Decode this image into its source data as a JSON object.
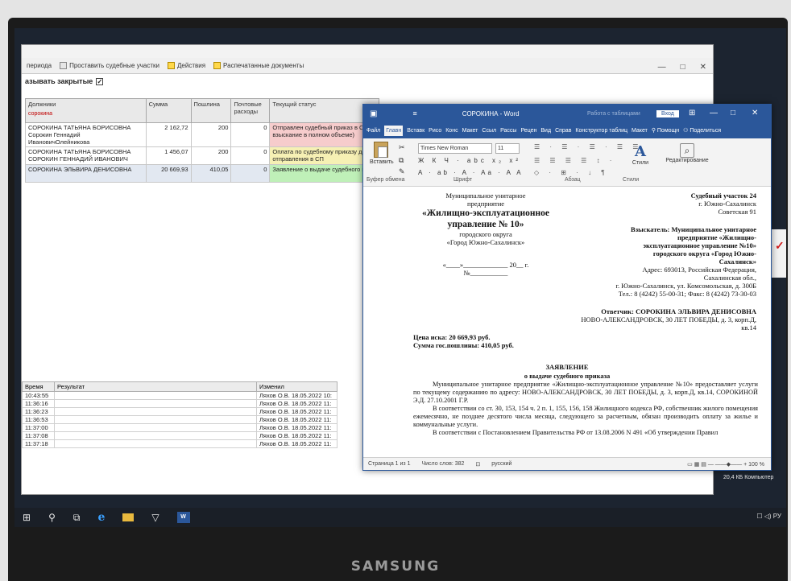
{
  "brand": "SAMSUNG",
  "app": {
    "menu": [
      {
        "label": "периода",
        "icon": "none"
      },
      {
        "label": "Проставить судебные участки",
        "icon": "grid"
      },
      {
        "label": "Действия",
        "icon": "yellow"
      },
      {
        "label": "Распечатанные документы",
        "icon": "yellow"
      }
    ],
    "window_buttons": [
      "—",
      "□",
      "✕"
    ],
    "show_closed_label": "азывать закрытые",
    "show_closed_checked": "✓",
    "grid": {
      "headers": {
        "debtor": "Должники",
        "debtor_filter": "сорокина",
        "sum": "Сумма",
        "duty": "Пошлина",
        "postal": "Почтовые расходы",
        "status": "Текущий статус"
      },
      "rows": [
        {
          "debtor": "СОРОКИНА ТАТЬЯНА БОРИСОВНА",
          "debtor2": "Сорокин Геннадий ИвановичОлейникова",
          "sum": "2 162,72",
          "duty": "200",
          "postal": "0",
          "status": "Отправлен судебный приказ в СП",
          "status2": "взыскание в полном объеме)",
          "status_color": "#f6cccc"
        },
        {
          "debtor": "СОРОКИНА ТАТЬЯНА БОРИСОВНА",
          "debtor2": "СОРОКИН ГЕННАДИЙ ИВАНОВИЧ",
          "sum": "1 456,07",
          "duty": "200",
          "postal": "0",
          "status": "Оплата по судебному приказу до",
          "status2": "отправления в СП",
          "status_color": "#f6f0b4"
        },
        {
          "debtor": "СОРОКИНА ЭЛЬВИРА ДЕНИСОВНА",
          "debtor2": "",
          "sum": "20 669,93",
          "duty": "410,05",
          "postal": "0",
          "status": "Заявление о выдаче судебного пр",
          "status2": "",
          "status_color": "#bff0b8"
        }
      ]
    },
    "log": {
      "headers": {
        "time": "Время",
        "result": "Результат",
        "changed": "Изменил"
      },
      "rows": [
        {
          "time": "10:43:55",
          "changed": "Ляхов О.В. 18.05.2022 10:"
        },
        {
          "time": "11:36:16",
          "changed": "Ляхов О.В. 18.05.2022 11:"
        },
        {
          "time": "11:36:23",
          "changed": "Ляхов О.В. 18.05.2022 11:"
        },
        {
          "time": "11:36:53",
          "changed": "Ляхов О.В. 18.05.2022 11:"
        },
        {
          "time": "11:37:00",
          "changed": "Ляхов О.В. 18.05.2022 11:"
        },
        {
          "time": "11:37:08",
          "changed": "Ляхов О.В. 18.05.2022 11:"
        },
        {
          "time": "11:37:18",
          "changed": "Ляхов О.В. 18.05.2022 11:"
        }
      ]
    }
  },
  "word": {
    "title": "СОРОКИНА - Word",
    "table_work": "Работа с таблицами",
    "login": "Вход",
    "tabs": [
      "Файл",
      "Главн",
      "Вставк",
      "Рисо",
      "Конс",
      "Макет",
      "Ссыл",
      "Рассы",
      "Рецен",
      "Вид",
      "Справ",
      "Конструктор таблиц",
      "Макет",
      "Помощн",
      "Поделиться"
    ],
    "ribbon": {
      "paste": "Вставить",
      "clipboard": "Буфер обмена",
      "font_name": "Times New Roman",
      "font_size": "11",
      "font_group": "Шрифт",
      "para_group": "Абзац",
      "styles": "Стили",
      "styles_group": "Стили",
      "editing": "Редактирование",
      "fmt_row1": "Ж К Ч · abc x₂ x²",
      "fmt_row2": "A · ab · A · Aa · A A",
      "para_row1": "☰ · ☰ · ☰ · ☰ ☰",
      "para_row2": "☰ ☰ ☰ ☰ ↕ ·",
      "para_row3": "◇ · ⊞ · ↓ ¶"
    },
    "doc": {
      "left": [
        "Муниципальное унитарное",
        "предприятие"
      ],
      "org": [
        "«Жилищно-эксплуатационное",
        "управление № 10»"
      ],
      "left2": [
        "городского округа",
        "«Город Южно-Сахалинск»"
      ],
      "date_line": "«____»_____________ 20__ г.",
      "num_line": "№___________",
      "court": [
        "Судебный участок 24",
        "г. Южно-Сахалинск",
        "Советская 91"
      ],
      "claimant": [
        "Взыскатель: Муниципальное унитарное",
        "предприятие «Жилищно-",
        "эксплуатационное управление №10»",
        "городского округа «Город Южно-",
        "Сахалинск»"
      ],
      "address": [
        "Адрес: 693013, Российская Федерация,",
        "Сахалинская обл.,",
        "г. Южно-Сахалинск, ул. Комсомольская, д. 300Б",
        "Тел.: 8 (4242) 55-00-31; Факс: 8 (4242) 73-30-03"
      ],
      "respondent": "Ответчик: СОРОКИНА ЭЛЬВИРА ДЕНИСОВНА",
      "resp_addr": [
        "НОВО-АЛЕКСАНДРОВСК, 30 ЛЕТ ПОБЕДЫ, д. 3, корп.Д,",
        "кв.14"
      ],
      "claim_price": "Цена иска:  20 669,93 руб.",
      "duty": "Сумма гос.пошлины: 410,05 руб.",
      "heading": "ЗАЯВЛЕНИЕ",
      "subheading": "о выдаче судебного приказа",
      "p1": "Муниципальное унитарное предприятие «Жилищно-эксплуатационное управление №10» предоставляет услуги по текущему содержанию по адресу: НОВО-АЛЕКСАНДРОВСК, 30 ЛЕТ ПОБЕДЫ, д. 3, корп.Д, кв.14, СОРОКИНОЙ Э.Д. 27.10.2001 Г.Р.",
      "p2": "В соответствии со ст. 30, 153, 154 ч. 2 п. 1, 155, 156, 158 Жилищного кодекса РФ, собственник жилого помещения ежемесячно, не позднее десятого числа месяца, следующего за расчетным, обязан производить оплату за жилье и коммунальные услуги.",
      "p3": "В соответствии с Постановлением Правительства РФ от 13.08.2006 N 491 «Об утверждении Правил"
    },
    "status": {
      "page": "Страница 1 из 1",
      "words": "Число слов: 382",
      "lang": "русский",
      "zoom": "100 %"
    }
  },
  "tray": {
    "size": "20,4 КБ",
    "computer": "Компьютер",
    "icons": "☐ ◁) РУ"
  }
}
